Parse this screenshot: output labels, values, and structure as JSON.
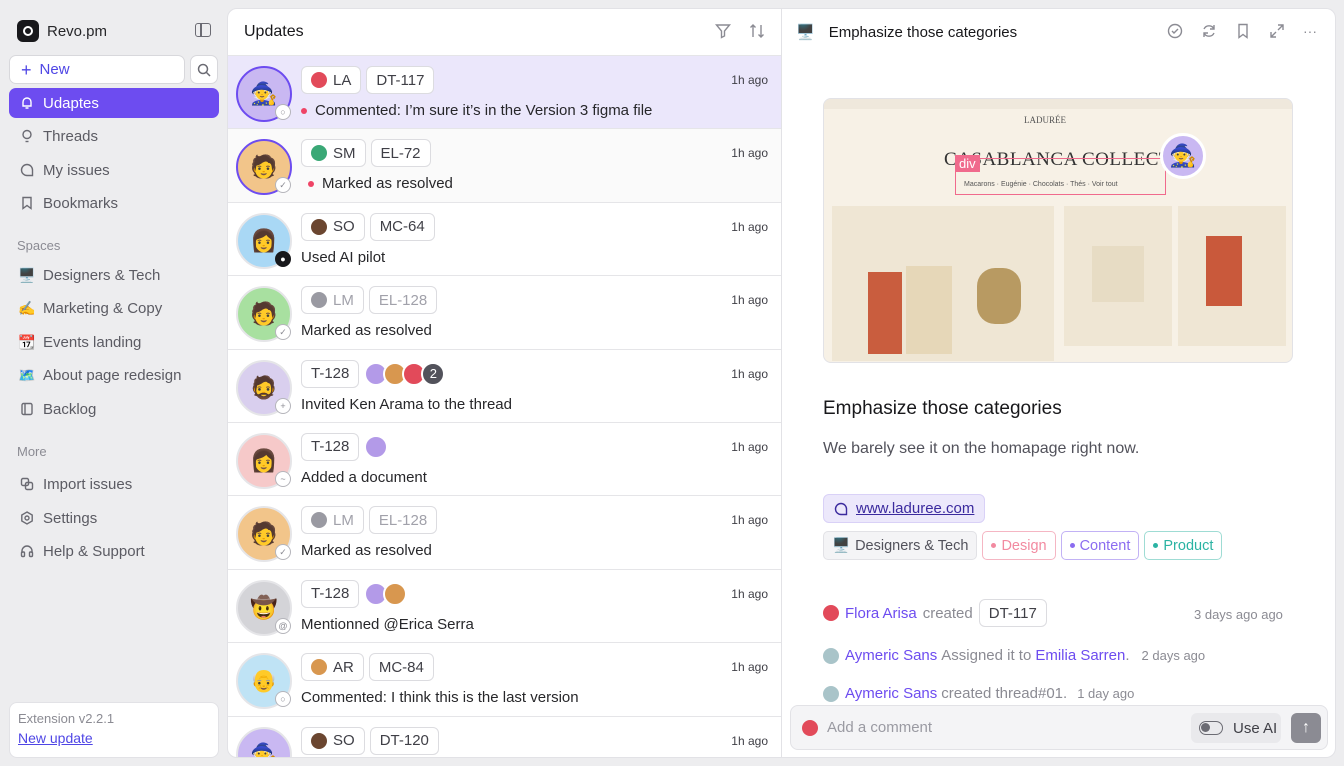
{
  "app": {
    "name": "Revo.pm"
  },
  "sidebar": {
    "new_label": "New",
    "nav": [
      {
        "label": "Udaptes",
        "icon": "bell-icon",
        "active": true
      },
      {
        "label": "Threads",
        "icon": "lightbulb-icon"
      },
      {
        "label": "My issues",
        "icon": "chat-bubble-icon"
      },
      {
        "label": "Bookmarks",
        "icon": "bookmark-icon"
      }
    ],
    "spaces_title": "Spaces",
    "spaces": [
      {
        "label": "Designers & Tech",
        "emoji": "🖥️"
      },
      {
        "label": "Marketing & Copy",
        "emoji": "✍️"
      },
      {
        "label": "Events landing",
        "emoji": "📆"
      },
      {
        "label": "About page redesign",
        "emoji": "🗺️"
      },
      {
        "label": "Backlog",
        "icon": "book-icon"
      }
    ],
    "more_title": "More",
    "more": [
      {
        "label": "Import issues",
        "icon": "import-icon"
      },
      {
        "label": "Settings",
        "icon": "gear-icon"
      },
      {
        "label": "Help & Support",
        "icon": "headphones-icon"
      }
    ],
    "extension": {
      "version": "Extension v2.2.1",
      "update_link": "New update"
    }
  },
  "updates": {
    "title": "Updates",
    "rows": [
      {
        "user": "LA",
        "ref": "DT-117",
        "message": "Commented: I’m sure it’s in the Version 3 figma file",
        "time": "1h ago",
        "unread": true,
        "selected": true
      },
      {
        "user": "SM",
        "ref": "EL-72",
        "message": "Marked as resolved",
        "time": "1h ago",
        "unread": true
      },
      {
        "user": "SO",
        "ref": "MC-64",
        "message": "Used AI pilot",
        "time": "1h ago"
      },
      {
        "user": "LM",
        "ref": "EL-128",
        "message": "Marked as resolved",
        "time": "1h ago",
        "muted_ref": true
      },
      {
        "ref": "T-128",
        "extra_count": "2",
        "message": "Invited Ken Arama to the thread",
        "time": "1h ago"
      },
      {
        "ref": "T-128",
        "message": "Added a document",
        "time": "1h ago"
      },
      {
        "user": "LM",
        "ref": "EL-128",
        "message": "Marked as resolved",
        "time": "1h ago",
        "muted_ref": true
      },
      {
        "ref": "T-128",
        "message": "Mentionned @Erica Serra",
        "time": "1h ago"
      },
      {
        "user": "AR",
        "ref": "MC-84",
        "message": "Commented: I think this is the last version",
        "time": "1h ago"
      },
      {
        "user": "SO",
        "ref": "DT-120",
        "message": "",
        "time": "1h ago"
      }
    ]
  },
  "detail": {
    "header_title": "Emphasize those categories",
    "preview": {
      "site_title": "CASABLANCA COLLECTIC",
      "brand": "LADURÉE",
      "highlight": "div",
      "subnav": "Macarons · Eugénie · Chocolats · Thés · Voir tout"
    },
    "title": "Emphasize those categories",
    "description": "We barely see it on the homapage right now.",
    "link": "www.laduree.com",
    "space": "Designers & Tech",
    "tags": [
      {
        "label": "Design",
        "color": "#f28aa0"
      },
      {
        "label": "Content",
        "color": "#8b6cf0"
      },
      {
        "label": "Product",
        "color": "#2bb3a3"
      }
    ],
    "activity": [
      {
        "who": "Flora Arisa",
        "verb": "created",
        "ref": "DT-117",
        "when": "3 days ago ago"
      },
      {
        "who": "Aymeric Sans",
        "verb": "Assigned it to",
        "target": "Emilia Sarren",
        "when": "2 days ago"
      },
      {
        "who": "Aymeric Sans",
        "verb": "created thread#01.",
        "when": "1 day ago"
      }
    ],
    "comment_placeholder": "Add a comment",
    "ai_label": "Use AI"
  }
}
